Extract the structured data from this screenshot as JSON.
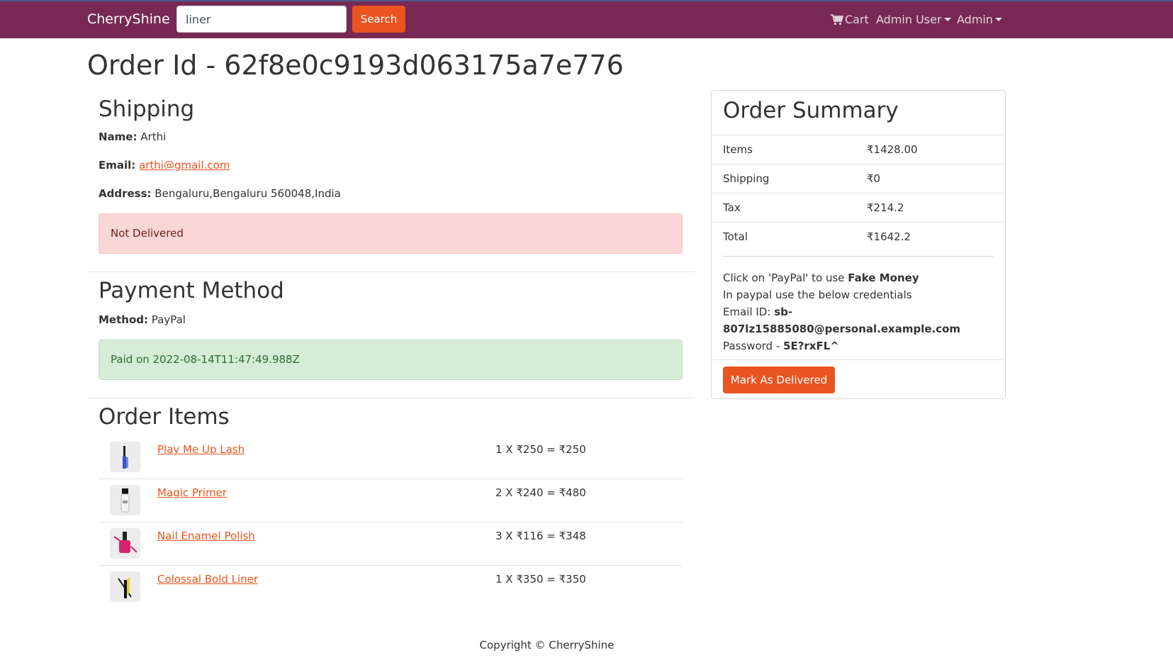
{
  "navbar": {
    "brand": "CherryShine",
    "search_value": "liner",
    "search_button": "Search",
    "cart_label": "Cart",
    "user_menu": "Admin User",
    "admin_menu": "Admin"
  },
  "page": {
    "title": "Order Id - 62f8e0c9193d063175a7e776"
  },
  "shipping": {
    "heading": "Shipping",
    "name_label": "Name:",
    "name": "Arthi",
    "email_label": "Email:",
    "email": "arthi@gmail.com",
    "address_label": "Address:",
    "address": "Bengaluru,Bengaluru 560048,India",
    "status": "Not Delivered"
  },
  "payment": {
    "heading": "Payment Method",
    "method_label": "Method:",
    "method": "PayPal",
    "status": "Paid on 2022-08-14T11:47:49.988Z"
  },
  "order_items": {
    "heading": "Order Items",
    "items": [
      {
        "name": "Play Me Up Lash",
        "calc": "1 X ₹250 = ₹250",
        "icon": "mascara-icon"
      },
      {
        "name": "Magic Primer",
        "calc": "2 X ₹240 = ₹480",
        "icon": "primer-bottle-icon"
      },
      {
        "name": "Nail Enamel Polish",
        "calc": "3 X ₹116 = ₹348",
        "icon": "nail-polish-icon"
      },
      {
        "name": "Colossal Bold Liner",
        "calc": "1 X ₹350 = ₹350",
        "icon": "eyeliner-icon"
      }
    ]
  },
  "summary": {
    "heading": "Order Summary",
    "rows": [
      {
        "label": "Items",
        "value": "₹1428.00"
      },
      {
        "label": "Shipping",
        "value": "₹0"
      },
      {
        "label": "Tax",
        "value": "₹214.2"
      },
      {
        "label": "Total",
        "value": "₹1642.2"
      }
    ],
    "note_line1_prefix": "Click on 'PayPal' to use ",
    "note_line1_bold": "Fake Money",
    "note_line2": "In paypal use the below credentials",
    "note_email_label": "Email ID: ",
    "note_email_part1": "sb-",
    "note_email_part2": "807lz15885080@personal.example.com",
    "note_password_label": "Password - ",
    "note_password": "5E?rxFL^",
    "deliver_button": "Mark As Delivered"
  },
  "footer": {
    "copyright": "Copyright © CherryShine"
  },
  "colors": {
    "navbar": "#772953",
    "accent": "#e95420",
    "danger_bg": "#f9d7d7",
    "success_bg": "#d5ecd7"
  }
}
